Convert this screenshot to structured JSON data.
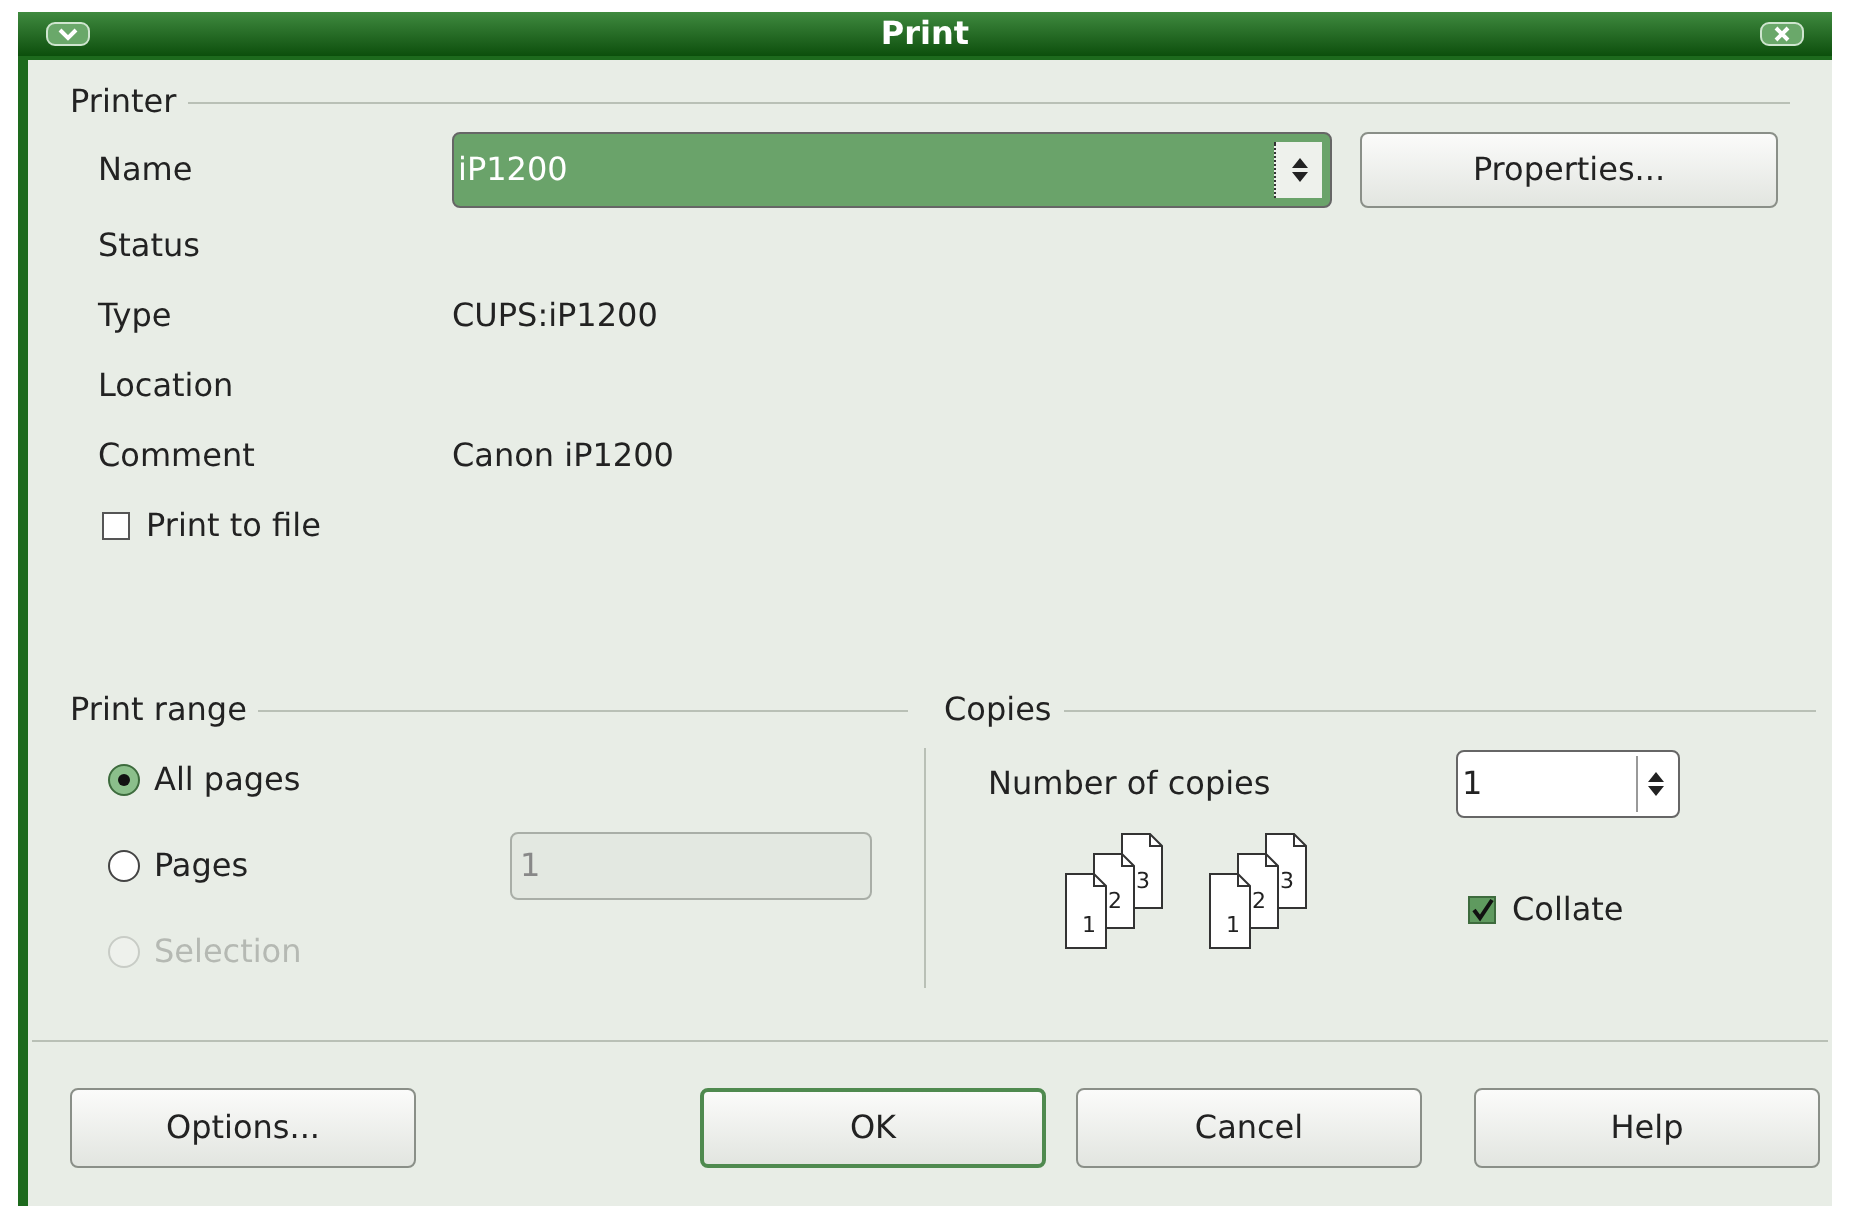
{
  "window": {
    "title": "Print"
  },
  "printer": {
    "heading": "Printer",
    "name_label": "Name",
    "name_value": "iP1200",
    "properties_button": "Properties...",
    "fields": [
      {
        "label": "Status"
      },
      {
        "label": "Type",
        "value": "CUPS:iP1200"
      },
      {
        "label": "Location"
      },
      {
        "label": "Comment",
        "value": "Canon iP1200"
      }
    ],
    "print_to_file": {
      "label": "Print to file",
      "checked": false
    }
  },
  "print_range": {
    "heading": "Print range",
    "options": [
      {
        "label": "All pages",
        "selected": true,
        "disabled": false
      },
      {
        "label": "Pages",
        "selected": false,
        "disabled": false
      },
      {
        "label": "Selection",
        "selected": false,
        "disabled": true
      }
    ],
    "pages_field": {
      "value": "1",
      "disabled": true
    }
  },
  "copies": {
    "heading": "Copies",
    "number_label": "Number of copies",
    "number_value": "1",
    "collate_icons": [
      {
        "pages": [
          "1",
          "2",
          "3"
        ]
      },
      {
        "pages": [
          "1",
          "2",
          "3"
        ]
      }
    ],
    "collate": {
      "label": "Collate",
      "checked": true
    }
  },
  "buttons": [
    {
      "label": "Options...",
      "default": false
    },
    {
      "label": "OK",
      "default": true
    },
    {
      "label": "Cancel",
      "default": false
    },
    {
      "label": "Help",
      "default": false
    }
  ]
}
